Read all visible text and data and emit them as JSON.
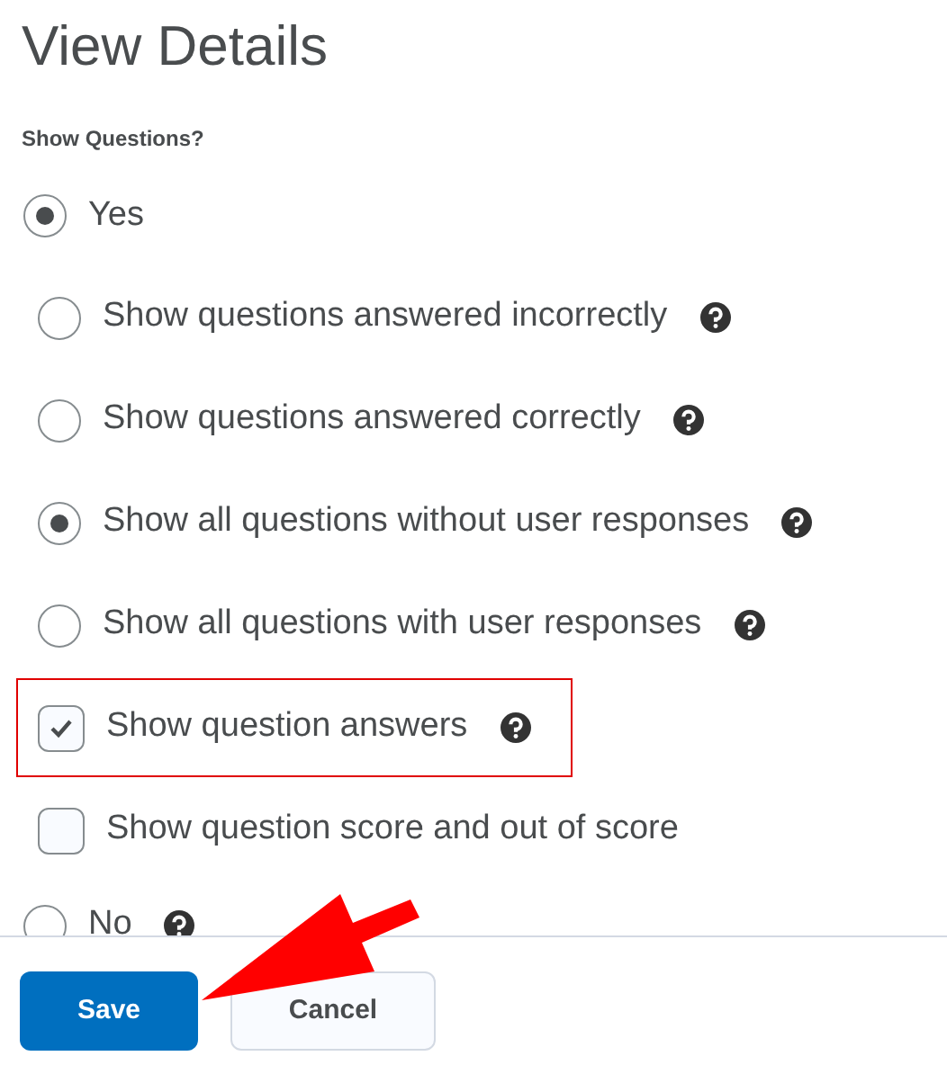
{
  "title": "View Details",
  "question": "Show Questions?",
  "options": [
    {
      "kind": "radio",
      "label": "Yes",
      "selected": true,
      "help": false,
      "children": [
        {
          "kind": "radio",
          "label": "Show questions answered incorrectly",
          "selected": false,
          "help": true,
          "highlighted": false
        },
        {
          "kind": "radio",
          "label": "Show questions answered correctly",
          "selected": false,
          "help": true,
          "highlighted": false
        },
        {
          "kind": "radio",
          "label": "Show all questions without user responses",
          "selected": true,
          "help": true,
          "highlighted": false
        },
        {
          "kind": "radio",
          "label": "Show all questions with user responses",
          "selected": false,
          "help": true,
          "highlighted": false
        },
        {
          "kind": "checkbox",
          "label": "Show question answers",
          "checked": true,
          "help": true,
          "highlighted": true
        },
        {
          "kind": "checkbox",
          "label": "Show question score and out of score",
          "checked": false,
          "help": false,
          "highlighted": false
        }
      ]
    },
    {
      "kind": "radio",
      "label": "No",
      "selected": false,
      "help": true
    }
  ],
  "buttons": [
    {
      "kind": "primary",
      "label": "Save"
    },
    {
      "kind": "secondary",
      "label": "Cancel"
    }
  ]
}
